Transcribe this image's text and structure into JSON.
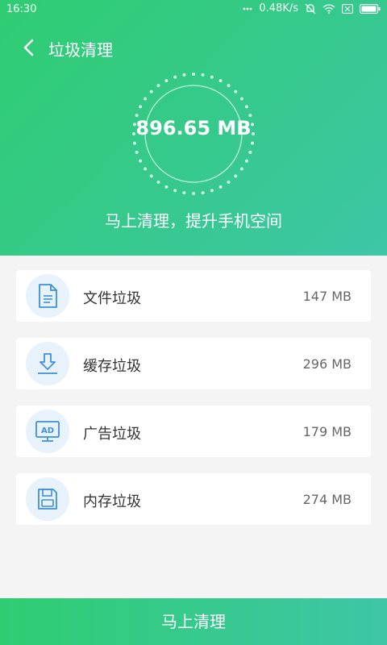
{
  "status_bar": {
    "time": "16:30",
    "network_speed": "0.48K/s",
    "icons": [
      "dots-icon",
      "mute-icon",
      "wifi-icon",
      "sim-icon",
      "battery-icon"
    ]
  },
  "nav": {
    "title": "垃圾清理",
    "back_icon": "chevron-left-icon"
  },
  "summary": {
    "total_size": "896.65 MB",
    "tagline": "马上清理，提升手机空间"
  },
  "categories": [
    {
      "label": "文件垃圾",
      "size": "147 MB",
      "icon": "file-icon"
    },
    {
      "label": "缓存垃圾",
      "size": "296 MB",
      "icon": "download-icon"
    },
    {
      "label": "广告垃圾",
      "size": "179 MB",
      "icon": "ad-icon"
    },
    {
      "label": "内存垃圾",
      "size": "274 MB",
      "icon": "memory-icon"
    }
  ],
  "action_button": {
    "label": "马上清理"
  },
  "colors": {
    "accent_green": "#2fcd72",
    "accent_teal": "#3ec6a7",
    "icon_blue": "#3d8fdc",
    "icon_bg": "#e8f2fb"
  }
}
